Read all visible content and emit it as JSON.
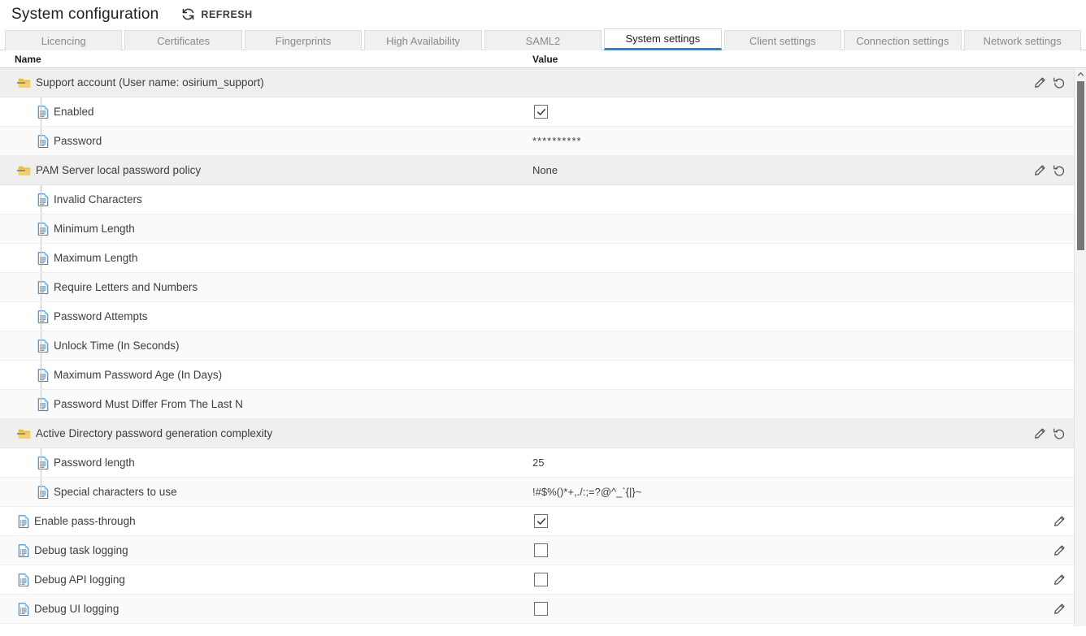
{
  "header": {
    "title": "System configuration",
    "refresh_label": "REFRESH",
    "refresh_icon": "refresh-icon"
  },
  "tabs": [
    {
      "label": "Licencing",
      "active": false
    },
    {
      "label": "Certificates",
      "active": false
    },
    {
      "label": "Fingerprints",
      "active": false
    },
    {
      "label": "High Availability",
      "active": false
    },
    {
      "label": "SAML2",
      "active": false
    },
    {
      "label": "System settings",
      "active": true
    },
    {
      "label": "Client settings",
      "active": false
    },
    {
      "label": "Connection settings",
      "active": false
    },
    {
      "label": "Network settings",
      "active": false
    }
  ],
  "grid": {
    "columns": {
      "name": "Name",
      "value": "Value"
    },
    "rows": [
      {
        "name": "Support account (User name: osirium_support)",
        "value": "",
        "value_type": "text",
        "kind": "group",
        "depth": 0,
        "icon": "folder-icon",
        "actions": [
          "edit-icon",
          "reset-icon"
        ]
      },
      {
        "name": "Enabled",
        "value": "checked",
        "value_type": "checkbox",
        "kind": "leaf",
        "depth": 1,
        "icon": "document-icon",
        "actions": []
      },
      {
        "name": "Password",
        "value": "**********",
        "value_type": "password",
        "kind": "leaf",
        "depth": 1,
        "icon": "document-icon",
        "actions": []
      },
      {
        "name": "PAM Server local password policy",
        "value": "None",
        "value_type": "text",
        "kind": "group",
        "depth": 0,
        "icon": "folder-icon",
        "actions": [
          "edit-icon",
          "reset-icon"
        ]
      },
      {
        "name": "Invalid Characters",
        "value": "",
        "value_type": "text",
        "kind": "leaf",
        "depth": 1,
        "icon": "document-icon",
        "actions": []
      },
      {
        "name": "Minimum Length",
        "value": "",
        "value_type": "text",
        "kind": "leaf",
        "depth": 1,
        "icon": "document-icon",
        "actions": []
      },
      {
        "name": "Maximum Length",
        "value": "",
        "value_type": "text",
        "kind": "leaf",
        "depth": 1,
        "icon": "document-icon",
        "actions": []
      },
      {
        "name": "Require Letters and Numbers",
        "value": "",
        "value_type": "text",
        "kind": "leaf",
        "depth": 1,
        "icon": "document-icon",
        "actions": []
      },
      {
        "name": "Password Attempts",
        "value": "",
        "value_type": "text",
        "kind": "leaf",
        "depth": 1,
        "icon": "document-icon",
        "actions": []
      },
      {
        "name": "Unlock Time (In Seconds)",
        "value": "",
        "value_type": "text",
        "kind": "leaf",
        "depth": 1,
        "icon": "document-icon",
        "actions": []
      },
      {
        "name": "Maximum Password Age (In Days)",
        "value": "",
        "value_type": "text",
        "kind": "leaf",
        "depth": 1,
        "icon": "document-icon",
        "actions": []
      },
      {
        "name": "Password Must Differ From The Last N",
        "value": "",
        "value_type": "text",
        "kind": "leaf",
        "depth": 1,
        "icon": "document-icon",
        "actions": []
      },
      {
        "name": "Active Directory password generation complexity",
        "value": "",
        "value_type": "text",
        "kind": "group",
        "depth": 0,
        "icon": "folder-icon",
        "actions": [
          "edit-icon",
          "reset-icon"
        ]
      },
      {
        "name": "Password length",
        "value": "25",
        "value_type": "text",
        "kind": "leaf",
        "depth": 1,
        "icon": "document-icon",
        "actions": []
      },
      {
        "name": "Special characters to use",
        "value": "!#$%()*+,./:;=?@^_`{|}~",
        "value_type": "text",
        "kind": "leaf",
        "depth": 1,
        "icon": "document-icon",
        "actions": []
      },
      {
        "name": "Enable pass-through",
        "value": "checked",
        "value_type": "checkbox",
        "kind": "leaf",
        "depth": 0,
        "icon": "document-icon",
        "actions": [
          "edit-icon"
        ]
      },
      {
        "name": "Debug task logging",
        "value": "unchecked",
        "value_type": "checkbox",
        "kind": "leaf",
        "depth": 0,
        "icon": "document-icon",
        "actions": [
          "edit-icon"
        ]
      },
      {
        "name": "Debug API logging",
        "value": "unchecked",
        "value_type": "checkbox",
        "kind": "leaf",
        "depth": 0,
        "icon": "document-icon",
        "actions": [
          "edit-icon"
        ]
      },
      {
        "name": "Debug UI logging",
        "value": "unchecked",
        "value_type": "checkbox",
        "kind": "leaf",
        "depth": 0,
        "icon": "document-icon",
        "actions": [
          "edit-icon"
        ]
      }
    ]
  },
  "scrollbar": {
    "up_arrow_icon": "chevron-up-icon",
    "thumb_name": "vertical-scroll-thumb"
  },
  "colors": {
    "accent": "#1e88e5",
    "folder": "#f5bc2a",
    "document": "#2e86d6",
    "group_row": "#efefef",
    "stripe_row": "#fafafa"
  }
}
